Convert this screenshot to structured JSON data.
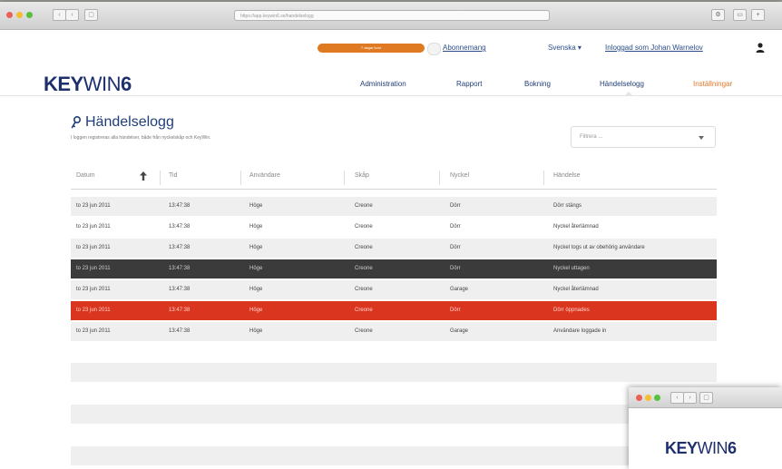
{
  "browser": {
    "url": "https://app.keywin6.se/handelselogg",
    "back_glyph": "‹",
    "forward_glyph": "›",
    "tab_glyph": "▢",
    "right_buttons": [
      "⚙",
      "▭",
      "+"
    ]
  },
  "topbar": {
    "pill_label": "7 dagar kvar",
    "subscription_link": "Abonnemang",
    "language": "Svenska ▾",
    "logged_in": "Inloggad som Johan Warnelov"
  },
  "brand": {
    "logo_bold": "KEY",
    "logo_thin": "WIN",
    "logo_tail": "6"
  },
  "nav": {
    "items": [
      "Administration",
      "Rapport",
      "Bokning",
      "Händelselogg",
      "Inställningar"
    ],
    "active": "Händelselogg"
  },
  "page": {
    "title": "Händelselogg",
    "subtitle": "I loggen registreras alla händelser, både från nyckelskåp och KeyWin.",
    "filter_placeholder": "Filtrera ..."
  },
  "table": {
    "columns": [
      "Datum",
      "Tid",
      "Användare",
      "Skåp",
      "Nyckel",
      "Händelse"
    ],
    "rows": [
      {
        "date": "to 23 jun 2011",
        "time": "13:47:38",
        "user": "Höge",
        "cabinet": "Creone",
        "key": "Dörr",
        "event": "Dörr stängs",
        "style": "alt"
      },
      {
        "date": "to 23 jun 2011",
        "time": "13:47:38",
        "user": "Höge",
        "cabinet": "Creone",
        "key": "Dörr",
        "event": "Nyckel återlämnad",
        "style": "plain"
      },
      {
        "date": "to 23 jun 2011",
        "time": "13:47:38",
        "user": "Höge",
        "cabinet": "Creone",
        "key": "Dörr",
        "event": "Nyckel togs ut av obehörig användare",
        "style": "alt"
      },
      {
        "date": "to 23 jun 2011",
        "time": "13:47:38",
        "user": "Höge",
        "cabinet": "Creone",
        "key": "Dörr",
        "event": "Nyckel uttagen",
        "style": "dark"
      },
      {
        "date": "to 23 jun 2011",
        "time": "13:47:38",
        "user": "Höge",
        "cabinet": "Creone",
        "key": "Garage",
        "event": "Nyckel återlämnad",
        "style": "alt"
      },
      {
        "date": "to 23 jun 2011",
        "time": "13:47:38",
        "user": "Höge",
        "cabinet": "Creone",
        "key": "Dörr",
        "event": "Dörr öppnades",
        "style": "red"
      },
      {
        "date": "to 23 jun 2011",
        "time": "13:47:38",
        "user": "Höge",
        "cabinet": "Creone",
        "key": "Garage",
        "event": "Användare loggade in",
        "style": "alt"
      }
    ]
  },
  "colors": {
    "brand_navy": "#1e2f6e",
    "accent_orange": "#e2772a",
    "selected_dark": "#3b3b3b",
    "alert_red": "#d9351f"
  },
  "icons": {
    "key": "key-icon",
    "sort": "arrow-up-icon",
    "user": "user-icon",
    "dropdown": "chevron-down-icon"
  }
}
